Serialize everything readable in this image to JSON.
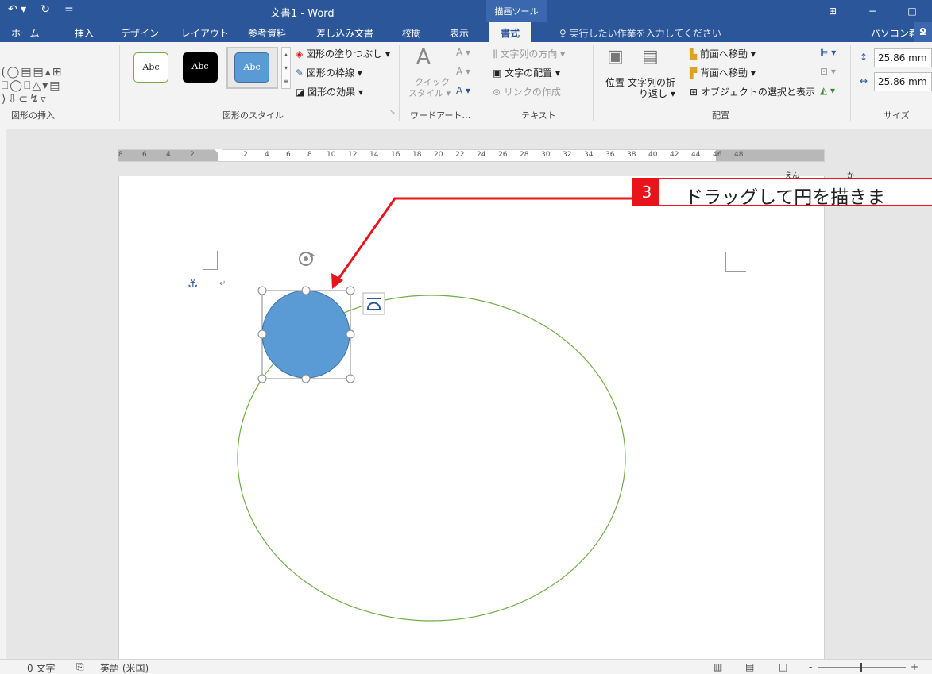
{
  "titlebar": {
    "undo_icon": "undo-icon",
    "redo_icon": "redo-icon",
    "customize": "=",
    "title": "文書1 - Word",
    "context_tab": "描画ツール",
    "restore_icon": "ribbon-display-icon",
    "minimize": "−",
    "maximize": "□"
  },
  "tabs": [
    {
      "label": "ホーム"
    },
    {
      "label": "挿入"
    },
    {
      "label": "デザイン"
    },
    {
      "label": "レイアウト"
    },
    {
      "label": "参考資料"
    },
    {
      "label": "差し込み文書"
    },
    {
      "label": "校閲"
    },
    {
      "label": "表示"
    },
    {
      "label": "書式"
    }
  ],
  "active_tab": "書式",
  "tellme": "実行したい作業を入力してください",
  "user": "パソコン教室",
  "user_icon": "Ջ",
  "ribbon": {
    "insert_shapes": {
      "label": "図形の挿入"
    },
    "shape_styles": {
      "label": "図形のスタイル",
      "samples": [
        "Abc",
        "Abc",
        "Abc"
      ],
      "fill": "図形の塗りつぶし ▾",
      "outline": "図形の枠線 ▾",
      "effects": "図形の効果 ▾"
    },
    "wordart": {
      "label": "ワードアート…",
      "quick_style_line1": "クイック",
      "quick_style_line2": "スタイル ▾"
    },
    "text": {
      "label": "テキスト",
      "direction": "文字列の方向 ▾",
      "align": "文字の配置 ▾",
      "link": "リンクの作成"
    },
    "arrange": {
      "label": "配置",
      "position": "位置",
      "wrap_line1": "文字列の折",
      "wrap_line2": "り返し ▾",
      "bring_forward": "前面へ移動",
      "send_backward": "背面へ移動",
      "selection_pane": "オブジェクトの選択と表示"
    },
    "size": {
      "label": "サイズ",
      "height": "25.86 mm",
      "width": "25.86 mm"
    }
  },
  "ruler_numbers": [
    "8",
    "6",
    "4",
    "2",
    "2",
    "4",
    "6",
    "8",
    "10",
    "12",
    "14",
    "16",
    "18",
    "20",
    "22",
    "24",
    "26",
    "28",
    "30",
    "32",
    "34",
    "36",
    "38",
    "40",
    "42",
    "44",
    "46",
    "48"
  ],
  "callout": {
    "number": "3",
    "text": "ドラッグして円を描きま",
    "ruby_en": "えん",
    "ruby_ka": "か"
  },
  "status": {
    "word_count": "0 文字",
    "language": "英語 (米国)",
    "zoom_minus": "-",
    "zoom_plus": "+"
  },
  "colors": {
    "title_blue": "#2b579a",
    "shape_fill": "#5b9bd5",
    "ellipse_stroke": "#70ad47",
    "callout_red": "#e8141a"
  }
}
